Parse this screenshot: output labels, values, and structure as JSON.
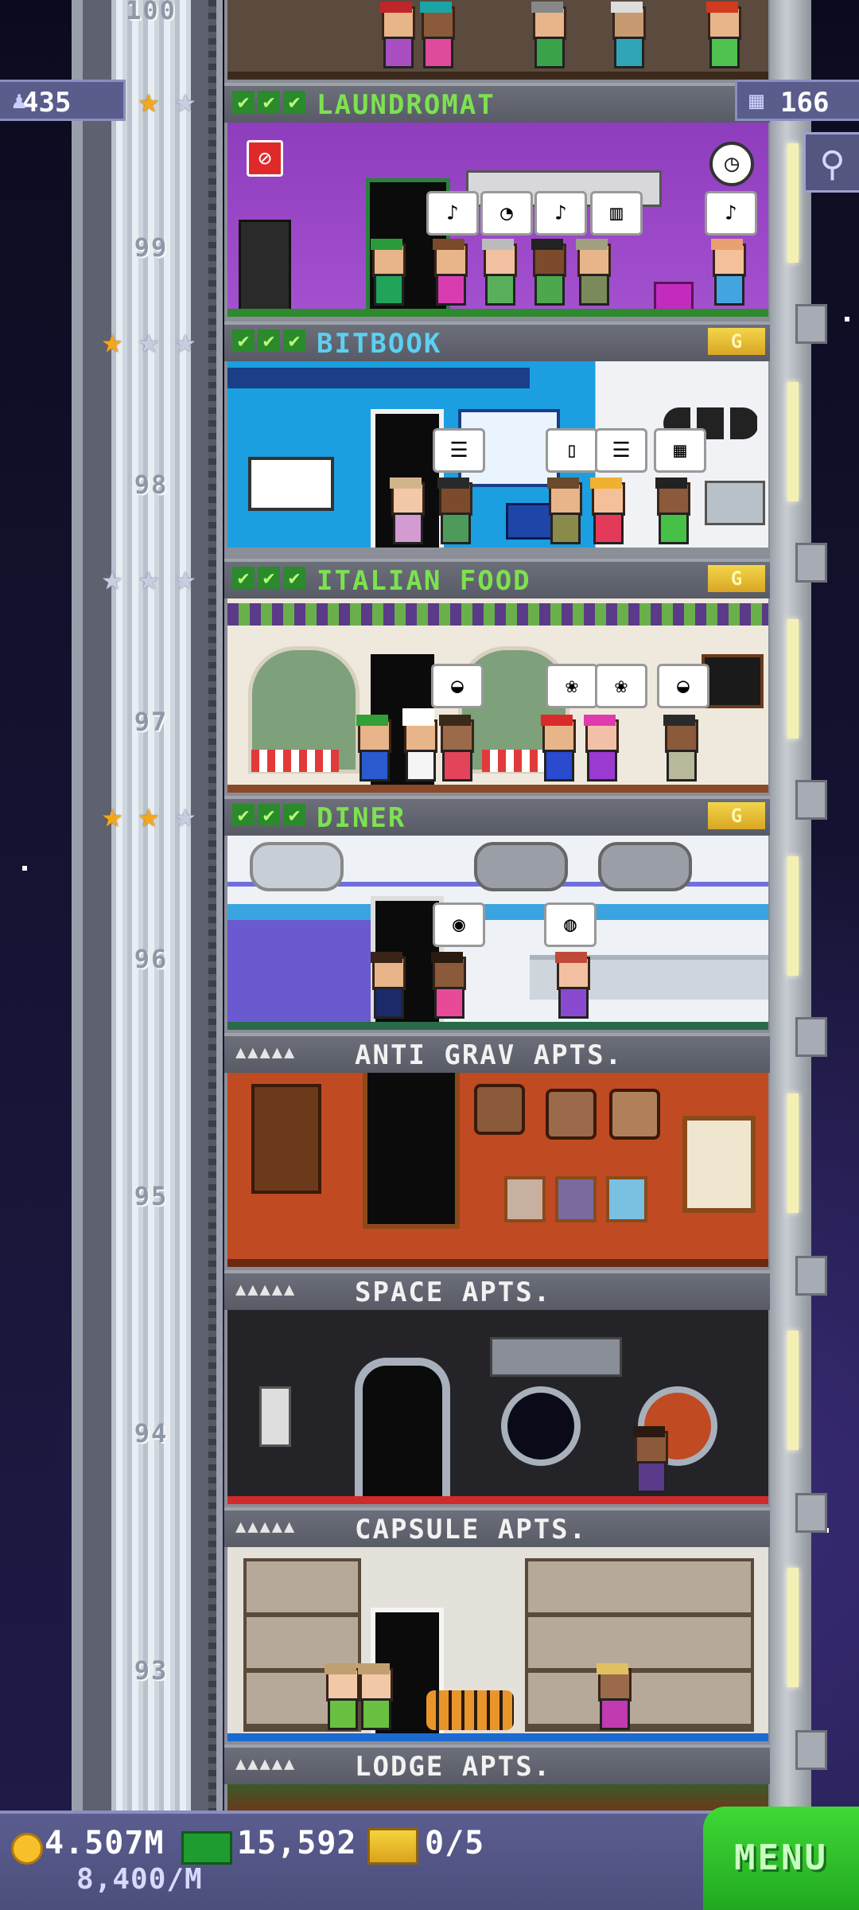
{
  "hud": {
    "population": "435",
    "floors_count": "166"
  },
  "shaft_floor_numbers": [
    "100",
    "99",
    "98",
    "97",
    "96",
    "95",
    "94",
    "93"
  ],
  "floors": [
    {
      "name": "LAUNDROMAT",
      "type": "business",
      "stars": [
        true,
        true,
        false
      ],
      "badge": "",
      "color": "#7ce24f"
    },
    {
      "name": "BITBOOK",
      "type": "business",
      "stars": [
        true,
        false,
        false
      ],
      "badge": "G",
      "color": "#5ad1f2"
    },
    {
      "name": "ITALIAN FOOD",
      "type": "business",
      "stars": [
        false,
        false,
        false
      ],
      "badge": "G",
      "color": "#7ce24f"
    },
    {
      "name": "DINER",
      "type": "business",
      "stars": [
        true,
        true,
        false
      ],
      "badge": "G",
      "color": "#7ce24f"
    },
    {
      "name": "ANTI GRAV APTS.",
      "type": "residential",
      "pips": "▲▲▲▲▲",
      "color": "#f2f2f2"
    },
    {
      "name": "SPACE APTS.",
      "type": "residential",
      "pips": "▲▲▲▲▲",
      "color": "#f2f2f2"
    },
    {
      "name": "CAPSULE APTS.",
      "type": "residential",
      "pips": "▲▲▲▲▲",
      "color": "#f2f2f2"
    },
    {
      "name": "LODGE APTS.",
      "type": "residential",
      "pips": "▲▲▲▲▲",
      "color": "#f2f2f2"
    }
  ],
  "bottom_bar": {
    "coins": "4.507M",
    "coins_rate": "8,400/M",
    "bux": "15,592",
    "tickets": "0/5",
    "menu_label": "MENU"
  },
  "colors": {
    "laundromat_wall": "#9b44c6",
    "bitbook_wall": "#1da6e6",
    "italian_wall": "#efe9dd",
    "diner_wall": "#eef2f6",
    "antigrav_wall": "#c04a22",
    "space_wall": "#242428",
    "capsule_wall": "#e4e0da",
    "menu_green": "#2ec02a"
  }
}
